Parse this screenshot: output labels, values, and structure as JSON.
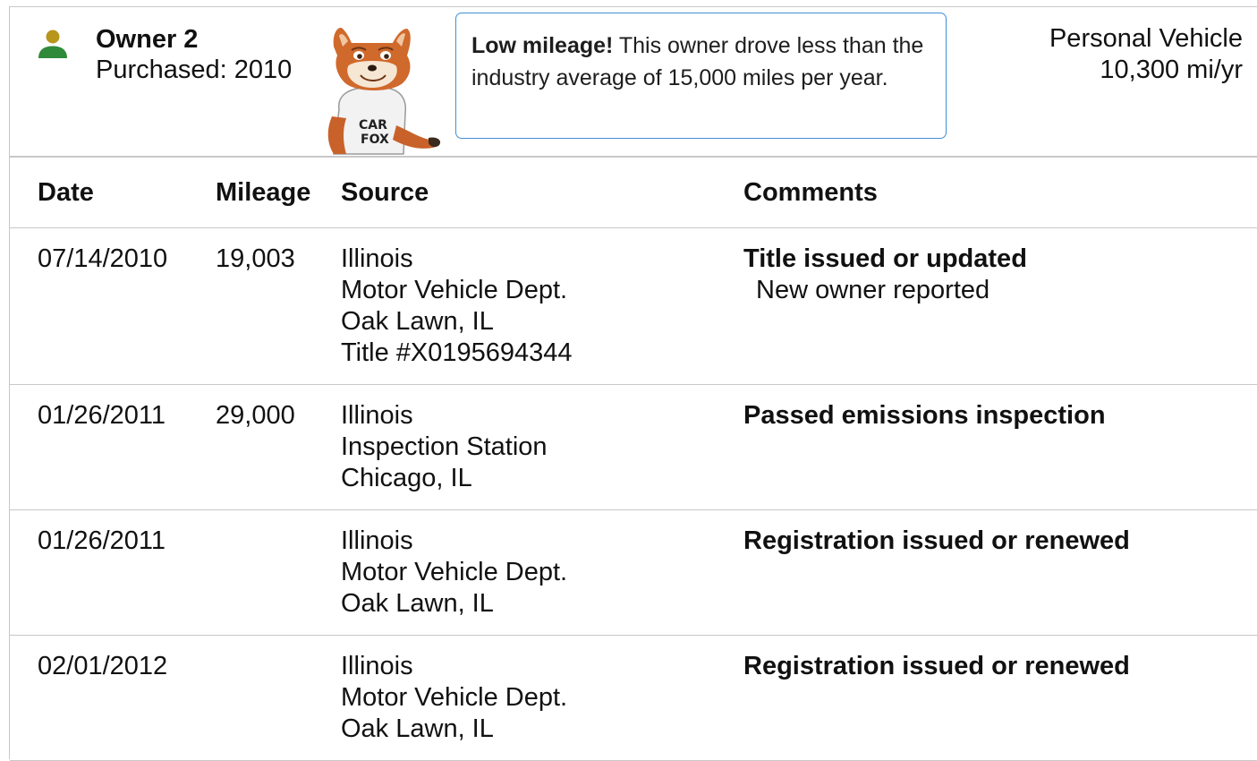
{
  "owner": {
    "name": "Owner 2",
    "purchased": "Purchased: 2010",
    "icon": "person-icon",
    "icon_colors": {
      "head": "#b8961c",
      "body": "#2f8a3a"
    }
  },
  "mascot": {
    "shirt_text_1": "CAR",
    "shirt_text_2": "FOX"
  },
  "tip": {
    "strong": "Low mileage!",
    "text": " This owner drove less than the industry average of 15,000 miles per year.",
    "border_color": "#3f8fd6"
  },
  "vehicle": {
    "type": "Personal Vehicle",
    "mileage_rate": "10,300 mi/yr"
  },
  "table": {
    "headers": {
      "date": "Date",
      "mileage": "Mileage",
      "source": "Source",
      "comments": "Comments"
    },
    "rows": [
      {
        "date": "07/14/2010",
        "mileage": "19,003",
        "source": [
          "Illinois",
          "Motor Vehicle Dept.",
          "Oak Lawn, IL",
          "Title #X0195694344"
        ],
        "comment_title": "Title issued or updated",
        "comment_detail": "New owner reported"
      },
      {
        "date": "01/26/2011",
        "mileage": "29,000",
        "source": [
          "Illinois",
          "Inspection Station",
          "Chicago, IL"
        ],
        "comment_title": "Passed emissions inspection",
        "comment_detail": ""
      },
      {
        "date": "01/26/2011",
        "mileage": "",
        "source": [
          "Illinois",
          "Motor Vehicle Dept.",
          "Oak Lawn, IL"
        ],
        "comment_title": "Registration issued or renewed",
        "comment_detail": ""
      },
      {
        "date": "02/01/2012",
        "mileage": "",
        "source": [
          "Illinois",
          "Motor Vehicle Dept.",
          "Oak Lawn, IL"
        ],
        "comment_title": "Registration issued or renewed",
        "comment_detail": ""
      }
    ]
  }
}
